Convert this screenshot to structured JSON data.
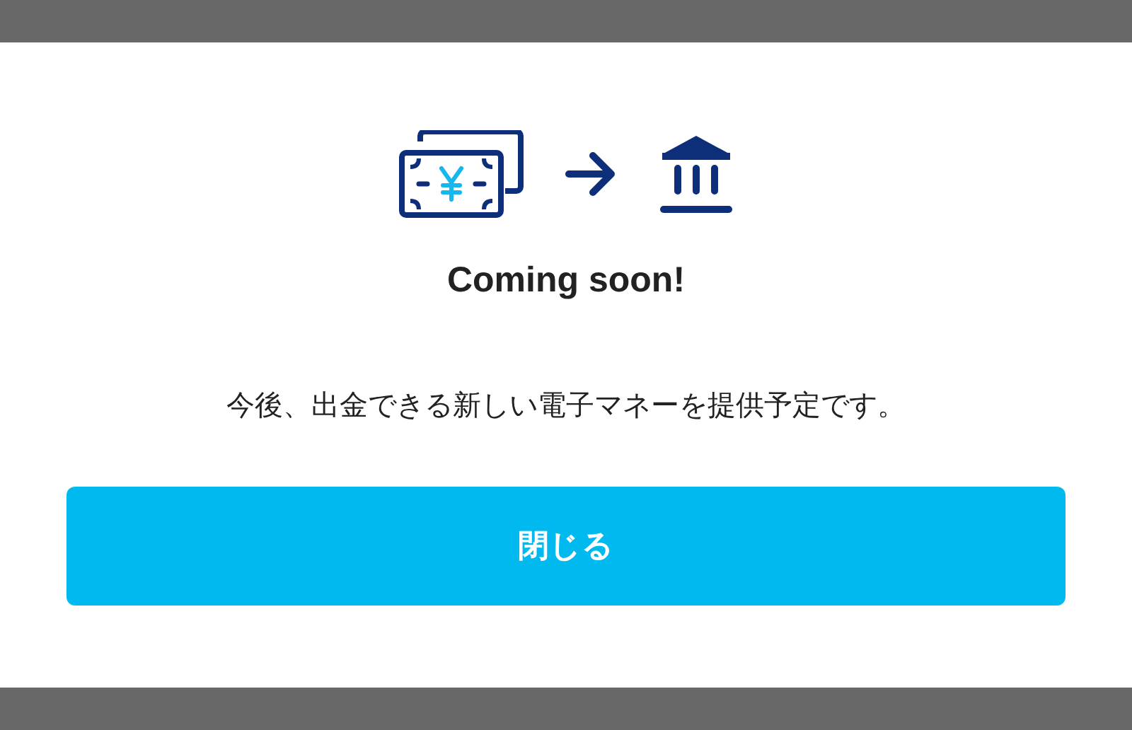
{
  "dialog": {
    "title": "Coming soon!",
    "message": "今後、出金できる新しい電子マネーを提供予定です。",
    "button": "閉じる"
  }
}
